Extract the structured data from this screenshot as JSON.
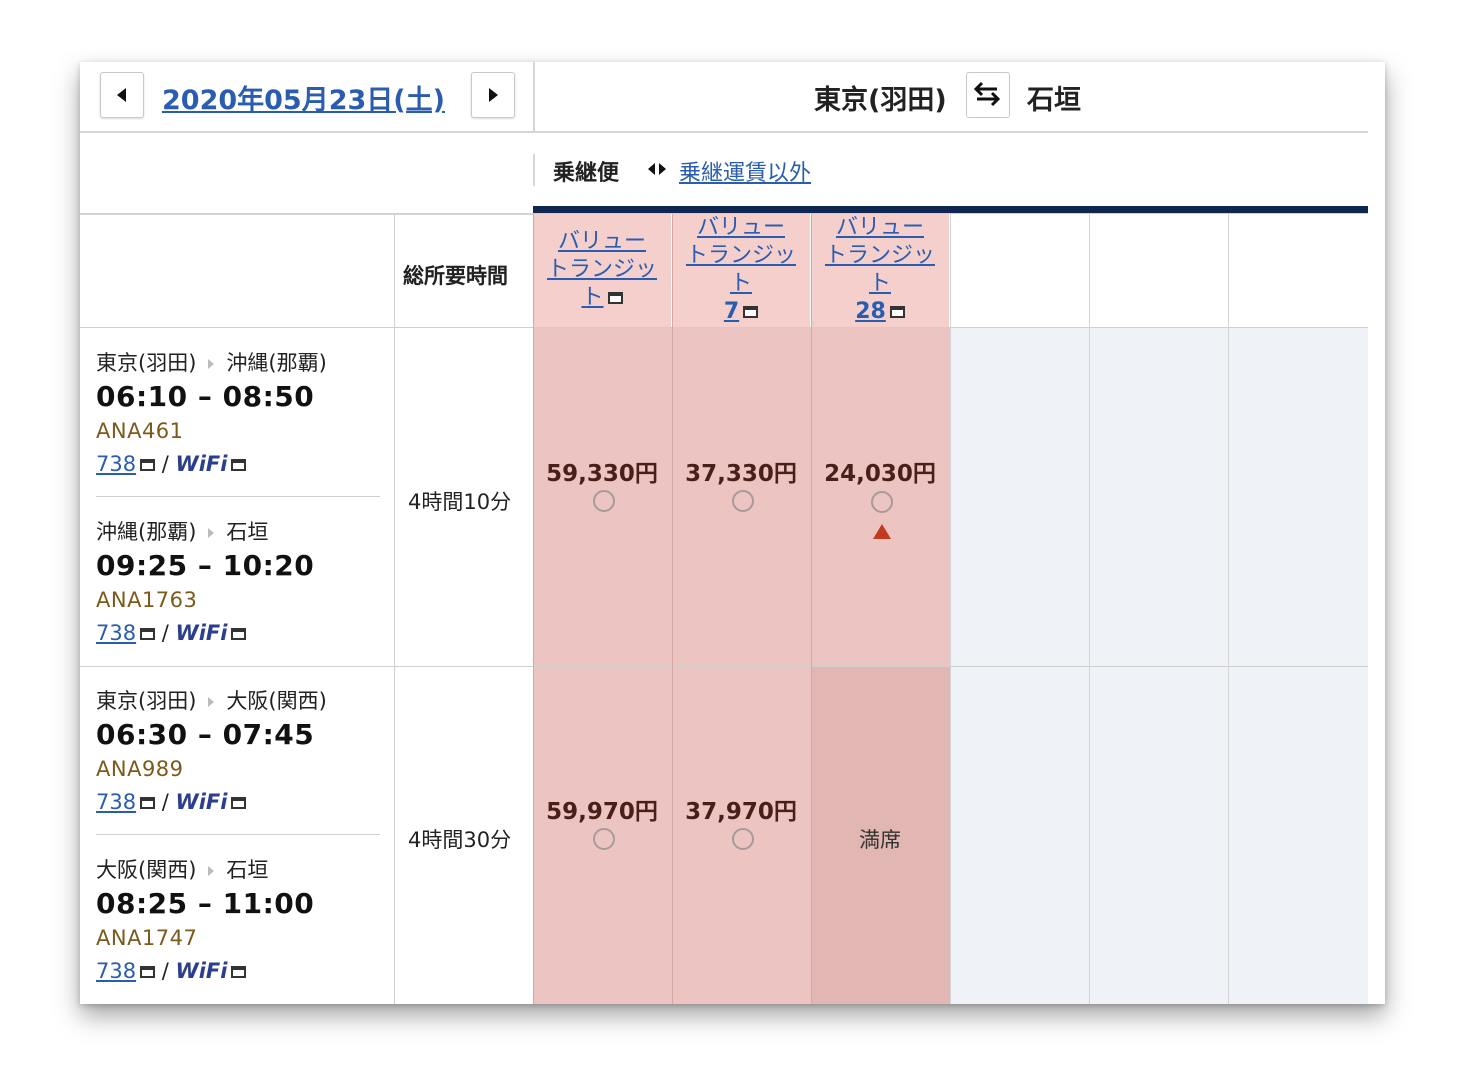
{
  "header": {
    "date": "2020年05月23日(土)",
    "origin": "東京(羽田)",
    "destination": "石垣"
  },
  "subheader": {
    "active_tab": "乗継便",
    "other_tab": "乗継運賃以外"
  },
  "table": {
    "duration_header": "総所要時間",
    "fare_columns": [
      {
        "name": "バリュートランジット",
        "name_lines": [
          "バリュー",
          "トランジッ",
          "ト"
        ],
        "suffix": ""
      },
      {
        "name": "バリュートランジット7",
        "name_lines": [
          "バリュー",
          "トランジッ",
          "ト",
          "7"
        ],
        "suffix": "7"
      },
      {
        "name": "バリュートランジット28",
        "name_lines": [
          "バリュー",
          "トランジッ",
          "ト",
          "28"
        ],
        "suffix": "28"
      }
    ],
    "rows": [
      {
        "legs": [
          {
            "from": "東京(羽田)",
            "to": "沖縄(那覇)",
            "time": "06:10 – 08:50",
            "flight": "ANA461",
            "equipment": "738",
            "wifi": "WiFi"
          },
          {
            "from": "沖縄(那覇)",
            "to": "石垣",
            "time": "09:25 – 10:20",
            "flight": "ANA1763",
            "equipment": "738",
            "wifi": "WiFi"
          }
        ],
        "duration": "4時間10分",
        "fares": [
          {
            "price": "59,330円",
            "status": "available"
          },
          {
            "price": "37,330円",
            "status": "available"
          },
          {
            "price": "24,030円",
            "status": "available",
            "warning": true
          }
        ]
      },
      {
        "legs": [
          {
            "from": "東京(羽田)",
            "to": "大阪(関西)",
            "time": "06:30 – 07:45",
            "flight": "ANA989",
            "equipment": "738",
            "wifi": "WiFi"
          },
          {
            "from": "大阪(関西)",
            "to": "石垣",
            "time": "08:25 – 11:00",
            "flight": "ANA1747",
            "equipment": "738",
            "wifi": "WiFi"
          }
        ],
        "duration": "4時間30分",
        "fares": [
          {
            "price": "59,970円",
            "status": "available"
          },
          {
            "price": "37,970円",
            "status": "available"
          },
          {
            "price": "",
            "status": "満席"
          }
        ]
      }
    ]
  },
  "colors": {
    "highlight": "#ecc4c1",
    "header_highlight": "#f5cfcc",
    "empty_col": "#eff3f8",
    "link": "#2a5db0",
    "navy_bar": "#0f2650",
    "warning": "#c23b1f"
  }
}
